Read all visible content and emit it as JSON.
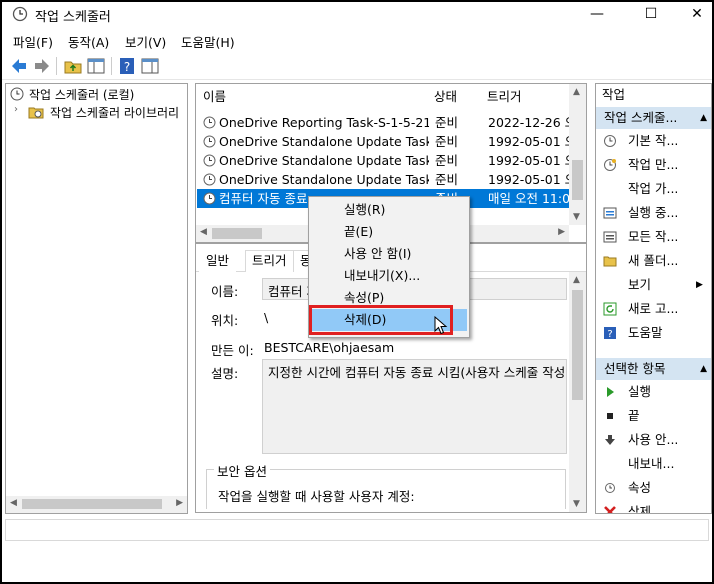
{
  "window": {
    "title": "작업 스케줄러",
    "minimize": "—",
    "maximize": "☐",
    "close": "✕"
  },
  "menu": [
    "파일(F)",
    "동작(A)",
    "보기(V)",
    "도움말(H)"
  ],
  "tree": {
    "root": "작업 스케줄러 (로컬)",
    "child": "작업 스케줄러 라이브러리"
  },
  "tasklist": {
    "columns": [
      "이름",
      "상태",
      "트리거"
    ],
    "rows": [
      {
        "name": "OneDrive Reporting Task-S-1-5-21-3...",
        "status": "준비",
        "trigger": "2022-12-26 오"
      },
      {
        "name": "OneDrive Standalone Update Task-S-...",
        "status": "준비",
        "trigger": "1992-05-01 오"
      },
      {
        "name": "OneDrive Standalone Update Task-S-...",
        "status": "준비",
        "trigger": "1992-05-01 오"
      },
      {
        "name": "OneDrive Standalone Update Task-S-...",
        "status": "준비",
        "trigger": "1992-05-01 오"
      },
      {
        "name": "컴퓨터 자동 종료",
        "status": "준비",
        "trigger": "매일 오전 11:0"
      }
    ]
  },
  "detail": {
    "tabs": [
      "일반",
      "트리거",
      "동"
    ],
    "name_label": "이름:",
    "name_value": "컴퓨터 자",
    "location_label": "위치:",
    "location_value": "\\",
    "author_label": "만든 이:",
    "author_value": "BESTCARE\\ohjaesam",
    "desc_label": "설명:",
    "desc_value": "지정한 시간에 컴퓨터 자동 종료 시킴(사용자 스케줄 작성",
    "security_label": "보안 옵션",
    "security_text": "작업을 실행할 때 사용할 사용자 계정:"
  },
  "actions": {
    "header": "작업",
    "section1": "작업 스케줄...",
    "items1": [
      "기본 작...",
      "작업 만...",
      "작업 가...",
      "실행 중...",
      "모든 작...",
      "새 폴더...",
      "보기",
      "새로 고...",
      "도움말"
    ],
    "section2": "선택한 항목",
    "items2": [
      "실행",
      "끝",
      "사용 안...",
      "내보내...",
      "속성",
      "삭제"
    ]
  },
  "context_menu": [
    "실행(R)",
    "끝(E)",
    "사용 안 함(I)",
    "내보내기(X)...",
    "속성(P)",
    "삭제(D)"
  ],
  "colors": {
    "selection": "#0078d7",
    "menu_highlight": "#91c9f7",
    "emphasis_box": "#e02020"
  }
}
